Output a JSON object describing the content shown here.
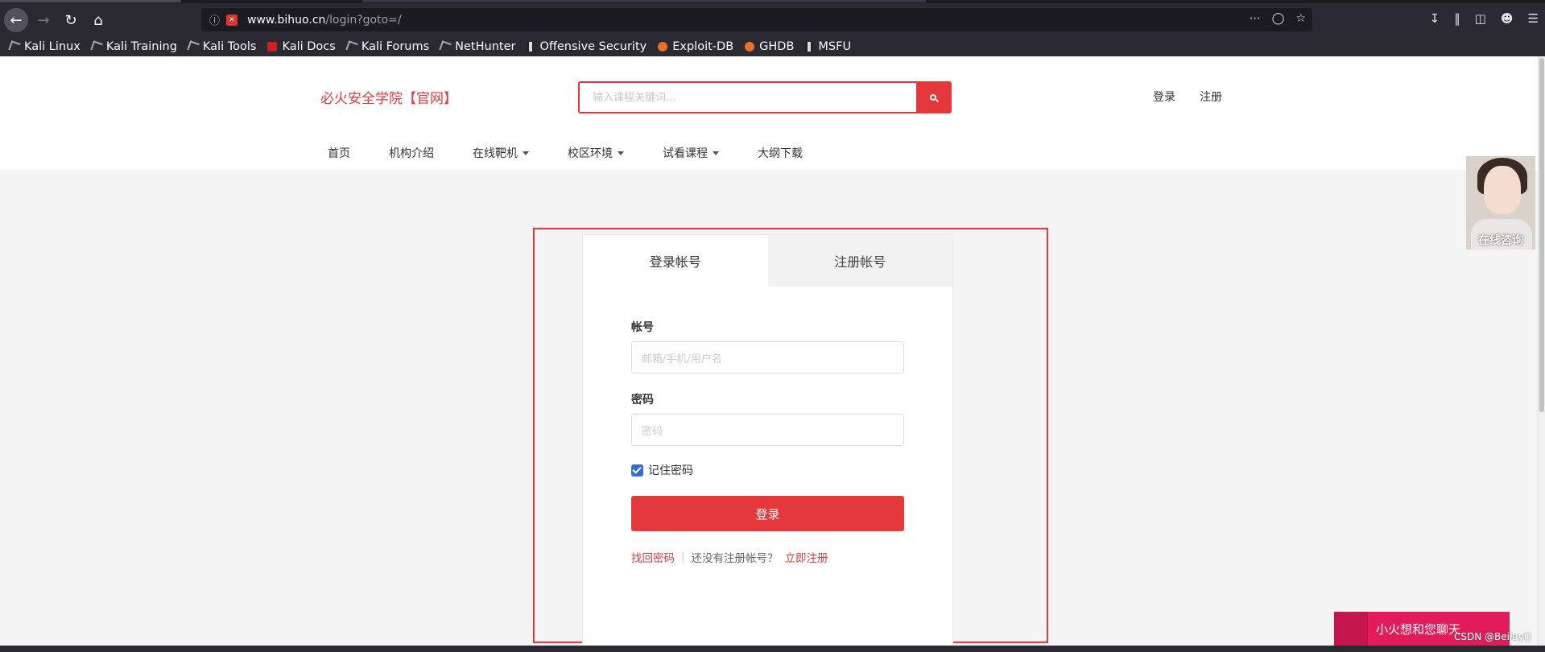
{
  "browser": {
    "url_host": "www.bihuo.cn",
    "url_path": "/login?goto=/",
    "bookmarks": [
      {
        "label": "Kali Linux",
        "icon": "kali-icon"
      },
      {
        "label": "Kali Training",
        "icon": "kali-icon"
      },
      {
        "label": "Kali Tools",
        "icon": "kali-icon"
      },
      {
        "label": "Kali Docs",
        "icon": "kali-docs-icon"
      },
      {
        "label": "Kali Forums",
        "icon": "kali-icon"
      },
      {
        "label": "NetHunter",
        "icon": "nethunter-icon"
      },
      {
        "label": "Offensive Security",
        "icon": "offsec-icon"
      },
      {
        "label": "Exploit-DB",
        "icon": "exploitdb-icon"
      },
      {
        "label": "GHDB",
        "icon": "exploitdb-icon"
      },
      {
        "label": "MSFU",
        "icon": "offsec-icon"
      }
    ]
  },
  "site": {
    "logo": "必火安全学院【官网】",
    "search_placeholder": "输入课程关键词...",
    "header_links": {
      "login": "登录",
      "register": "注册"
    },
    "nav": [
      {
        "label": "首页",
        "dropdown": false
      },
      {
        "label": "机构介绍",
        "dropdown": false
      },
      {
        "label": "在线靶机",
        "dropdown": true
      },
      {
        "label": "校区环境",
        "dropdown": true
      },
      {
        "label": "试看课程",
        "dropdown": true
      },
      {
        "label": "大纲下载",
        "dropdown": false
      }
    ]
  },
  "login_card": {
    "tab_login": "登录帐号",
    "tab_register": "注册帐号",
    "account_label": "帐号",
    "account_placeholder": "邮箱/手机/用户名",
    "password_label": "密码",
    "password_placeholder": "密码",
    "remember_label": "记住密码",
    "remember_checked": true,
    "submit_label": "登录",
    "forgot_link": "找回密码",
    "separator": "|",
    "no_account_text": "还没有注册帐号？",
    "register_link": "立即注册"
  },
  "widgets": {
    "consult_label": "在线咨询",
    "chat_label": "小火想和您聊天",
    "watermark": "CSDN @Beilay()"
  },
  "colors": {
    "brand_red": "#e4393c",
    "chat_pink": "#e21b5a",
    "browser_dark": "#2b2a33"
  }
}
